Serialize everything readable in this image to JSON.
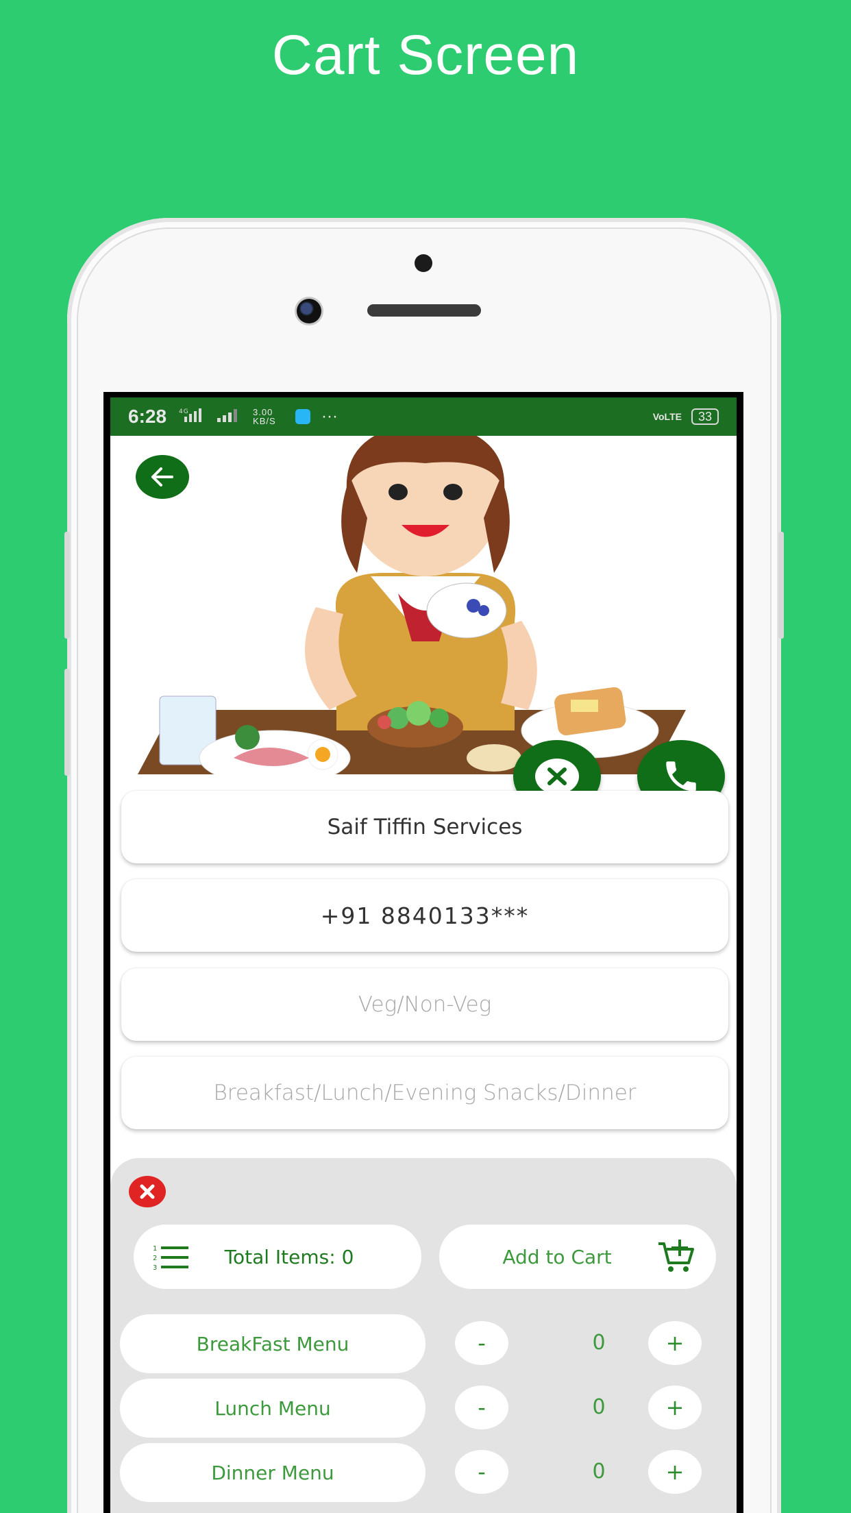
{
  "promo": {
    "title": "Cart Screen"
  },
  "statusbar": {
    "time": "6:28",
    "network_left": "4G",
    "speed": "3.00 KB/S",
    "more": "···",
    "volte": "VoLTE",
    "battery": "33"
  },
  "vendor": {
    "name": "Saif Tiffin Services",
    "phone": "+91 8840133***",
    "food_type_placeholder": "Veg/Non-Veg",
    "meal_time_placeholder": "Breakfast/Lunch/Evening Snacks/Dinner"
  },
  "cart": {
    "total_label": "Total Items: 0",
    "add_to_cart_label": "Add to Cart",
    "menus": [
      {
        "label": "BreakFast Menu",
        "minus": "-",
        "count": "0",
        "plus": "+"
      },
      {
        "label": "Lunch Menu",
        "minus": "-",
        "count": "0",
        "plus": "+"
      },
      {
        "label": "Dinner Menu",
        "minus": "-",
        "count": "0",
        "plus": "+"
      }
    ]
  },
  "icons": {
    "back": "arrow-left-icon",
    "close": "close-circle-icon",
    "call": "phone-icon",
    "list": "numbered-list-icon",
    "cart": "cart-plus-icon",
    "dismiss": "close-red-icon"
  },
  "colors": {
    "background": "#2ecc71",
    "primary_dark_green": "#0f6e17",
    "status_bar": "#1c6e22",
    "text_green": "#3c9a3c",
    "danger_red": "#e02424",
    "sheet_grey": "#e3e3e3"
  }
}
